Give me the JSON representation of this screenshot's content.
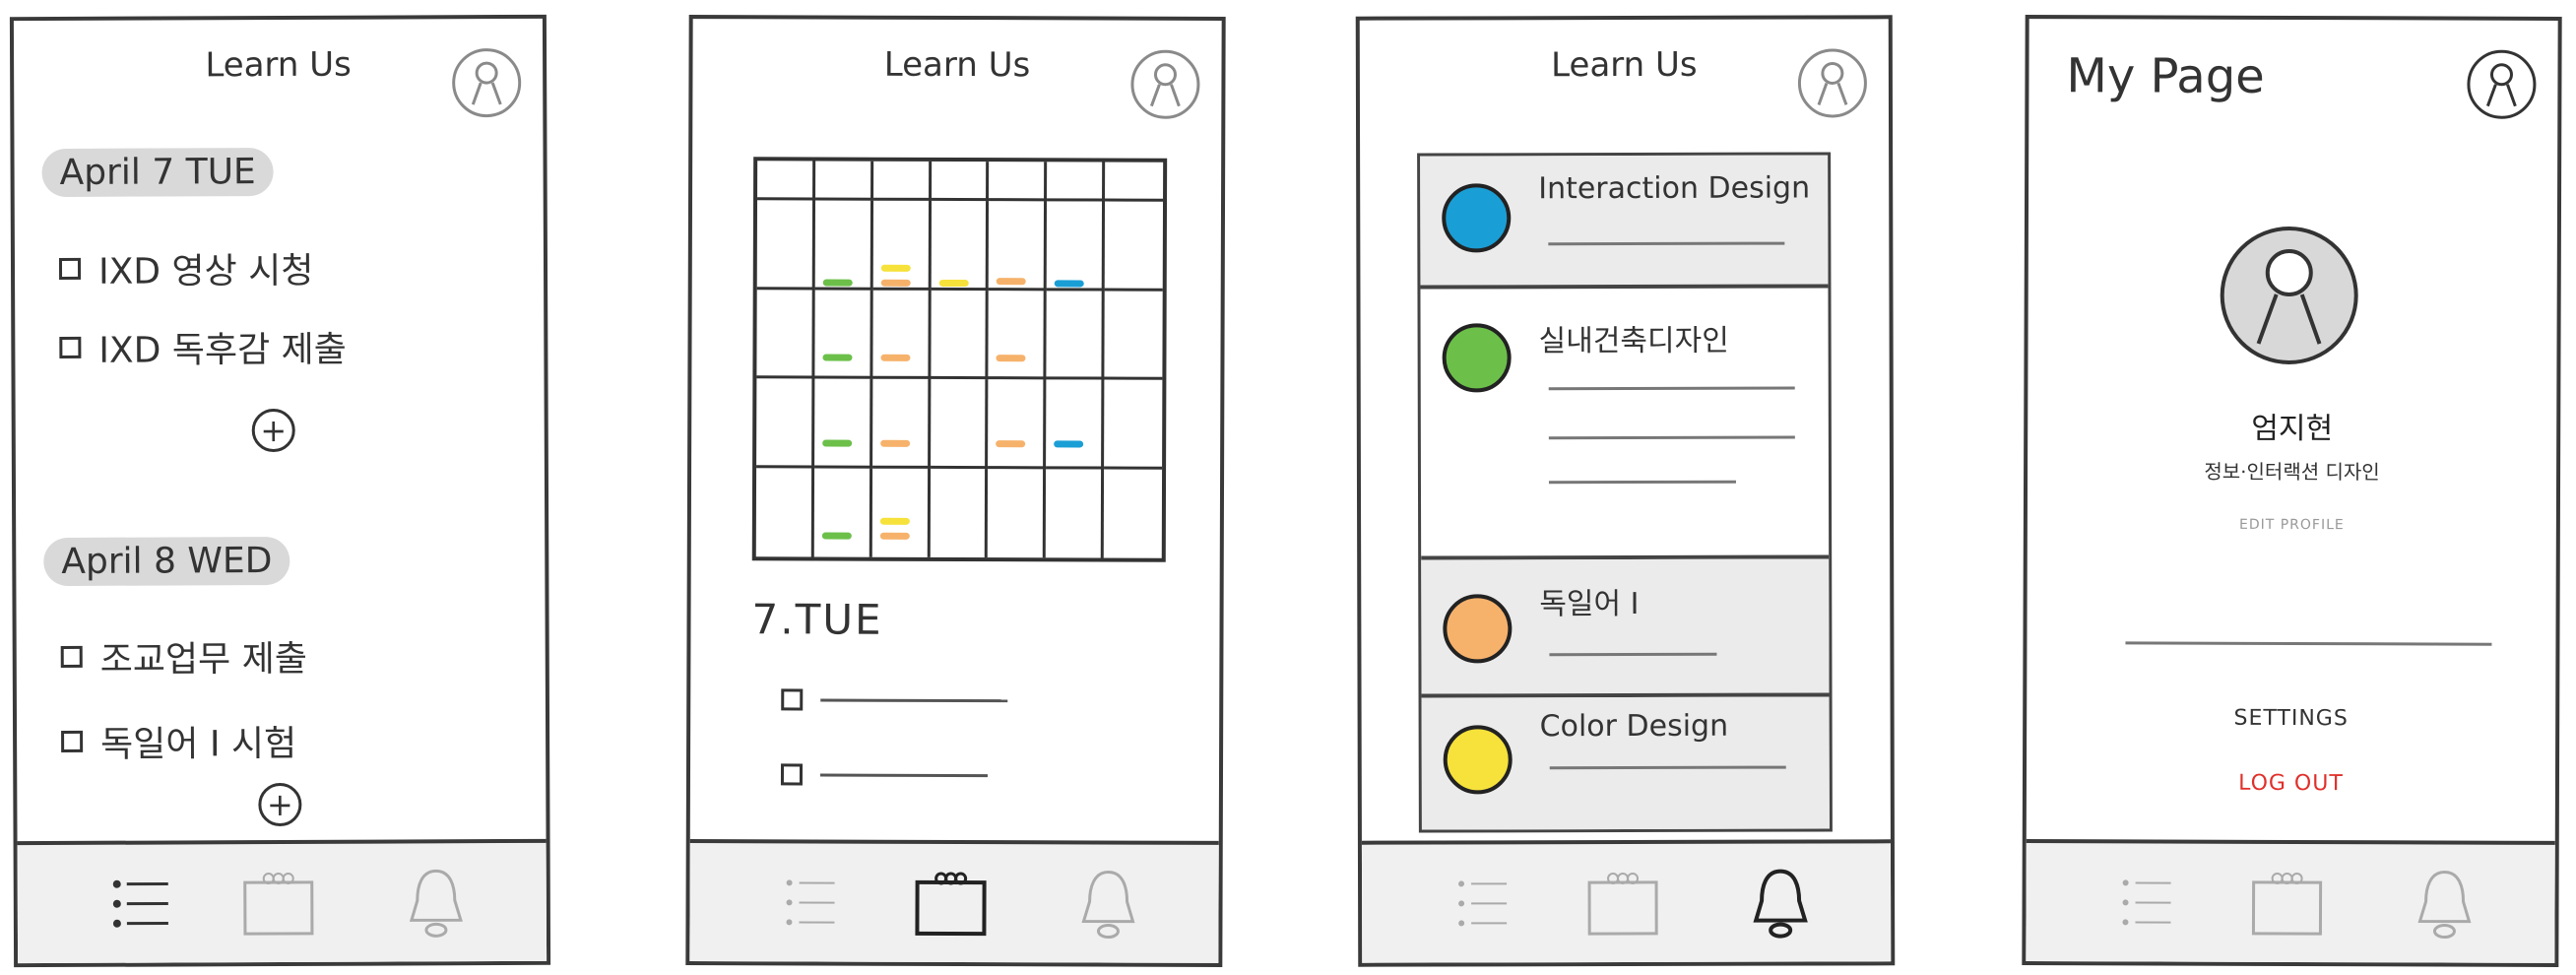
{
  "app": {
    "brand": "Learn Us"
  },
  "nav": {
    "items": [
      "list-icon",
      "calendar-icon",
      "bell-icon"
    ]
  },
  "screen1": {
    "days": [
      {
        "label": "April 7 TUE",
        "todos": [
          "IXD 영상 시청",
          "IXD 독후감 제출"
        ]
      },
      {
        "label": "April 8 WED",
        "todos": [
          "조교업무 제출",
          "독일어 I 시험"
        ]
      }
    ],
    "add_label": "+"
  },
  "screen2": {
    "selected_day": "7.TUE",
    "event_colors": {
      "green": "#6cc04a",
      "yellow": "#f6e23a",
      "orange": "#f6b26b",
      "blue": "#1a9ed6"
    }
  },
  "screen3": {
    "courses": [
      {
        "title": "Interaction Design",
        "color": "#1a9ed6"
      },
      {
        "title": "실내건축디자인",
        "color": "#6cc04a"
      },
      {
        "title": "독일어 I",
        "color": "#f6b26b"
      },
      {
        "title": "Color Design",
        "color": "#f6e23a"
      }
    ]
  },
  "screen4": {
    "title": "My Page",
    "user_name": "엄지현",
    "user_info": "정보·인터랙션 디자인",
    "edit_profile": "EDIT PROFILE",
    "settings": "SETTINGS",
    "logout": "LOG OUT"
  }
}
